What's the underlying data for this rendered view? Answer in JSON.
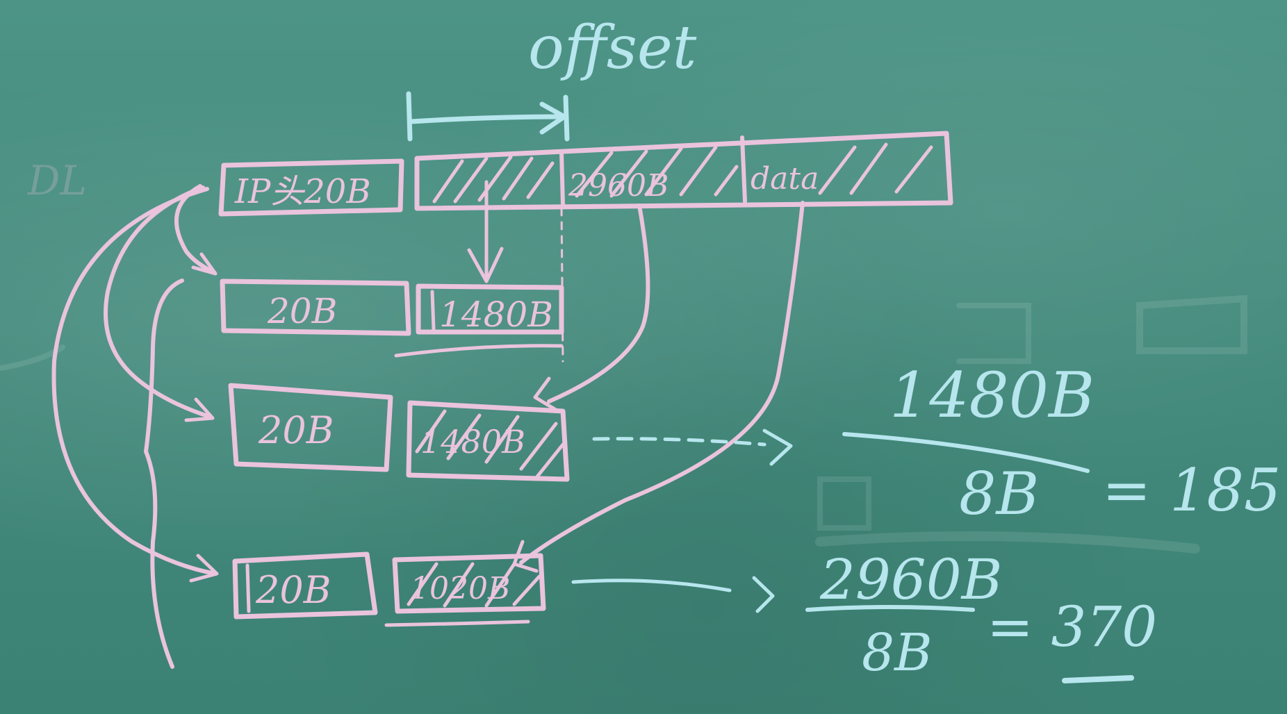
{
  "board": {
    "heading": "offset",
    "fragment_header_top": "IP头20B",
    "original_mid_label": "2960B",
    "original_right_label": "data",
    "fragment_1_header": "20B",
    "fragment_1_data": "1480B",
    "fragment_2_header": "20B",
    "fragment_2_data": "1480B",
    "fragment_3_header": "20B",
    "fragment_3_data": "1020B",
    "calc_1_numerator": "1480B",
    "calc_1_denominator": "8B",
    "calc_1_result": "= 185",
    "calc_2_numerator": "2960B",
    "calc_2_denominator": "8B",
    "calc_2_result": "= 370",
    "left_faint": "DL"
  },
  "colors": {
    "board_green": "#42897b",
    "chalk_pink": "#eac3dc",
    "chalk_blue": "#b7e6ee"
  }
}
